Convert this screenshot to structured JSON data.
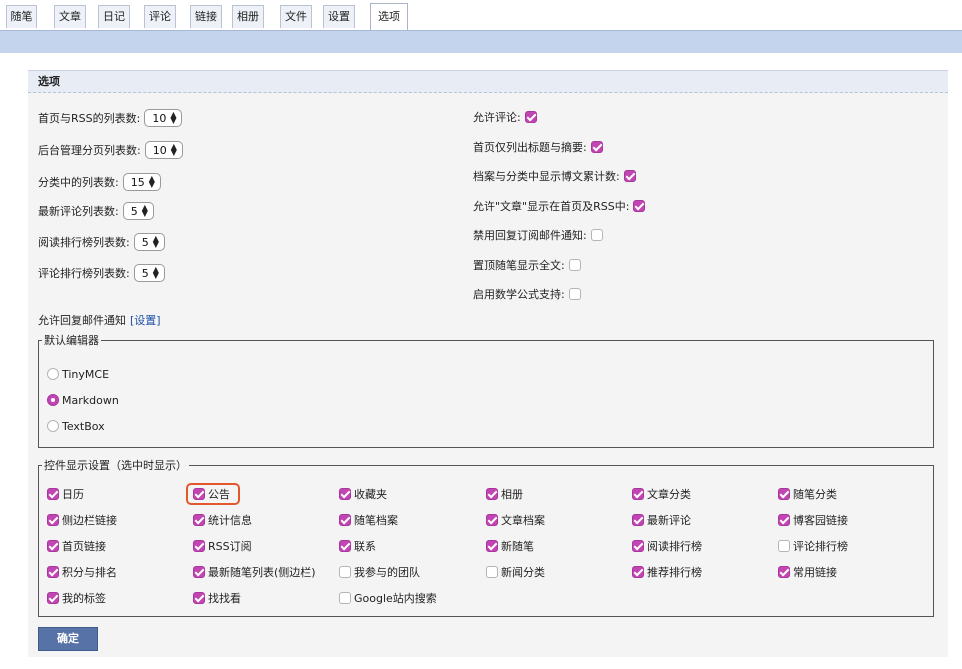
{
  "tabs": [
    "随笔",
    "文章",
    "日记",
    "评论",
    "链接",
    "相册",
    "文件",
    "设置",
    "选项"
  ],
  "active_tab": "选项",
  "panel_title": "选项",
  "left_settings": [
    {
      "label": "首页与RSS的列表数:",
      "value": "10"
    },
    {
      "label": "后台管理分页列表数:",
      "value": "10"
    },
    {
      "label": "分类中的列表数:",
      "value": "15"
    },
    {
      "label": "最新评论列表数:",
      "value": "5"
    },
    {
      "label": "阅读排行榜列表数:",
      "value": "5"
    },
    {
      "label": "评论排行榜列表数:",
      "value": "5"
    }
  ],
  "right_settings": [
    {
      "label": "允许评论:",
      "checked": true
    },
    {
      "label": "首页仅列出标题与摘要:",
      "checked": true
    },
    {
      "label": "档案与分类中显示博文累计数:",
      "checked": true
    },
    {
      "label": "允许\"文章\"显示在首页及RSS中:",
      "checked": true
    },
    {
      "label": "禁用回复订阅邮件通知:",
      "checked": false
    },
    {
      "label": "置顶随笔显示全文:",
      "checked": false
    },
    {
      "label": "启用数学公式支持:",
      "checked": false
    }
  ],
  "reply_notice": {
    "text": "允许回复邮件通知",
    "link": "[设置]"
  },
  "editor": {
    "legend": "默认编辑器",
    "options": [
      {
        "label": "TinyMCE",
        "selected": false
      },
      {
        "label": "Markdown",
        "selected": true
      },
      {
        "label": "TextBox",
        "selected": false
      }
    ]
  },
  "widgets": {
    "legend": "控件显示设置（选中时显示）",
    "rows": [
      [
        {
          "label": "日历",
          "checked": true
        },
        {
          "label": "公告",
          "checked": true,
          "highlight": true
        },
        {
          "label": "收藏夹",
          "checked": true
        },
        {
          "label": "相册",
          "checked": true
        },
        {
          "label": "文章分类",
          "checked": true
        },
        {
          "label": "随笔分类",
          "checked": true
        }
      ],
      [
        {
          "label": "侧边栏链接",
          "checked": true
        },
        {
          "label": "统计信息",
          "checked": true
        },
        {
          "label": "随笔档案",
          "checked": true
        },
        {
          "label": "文章档案",
          "checked": true
        },
        {
          "label": "最新评论",
          "checked": true
        },
        {
          "label": "博客园链接",
          "checked": true
        }
      ],
      [
        {
          "label": "首页链接",
          "checked": true
        },
        {
          "label": "RSS订阅",
          "checked": true
        },
        {
          "label": "联系",
          "checked": true
        },
        {
          "label": "新随笔",
          "checked": true
        },
        {
          "label": "阅读排行榜",
          "checked": true
        },
        {
          "label": "评论排行榜",
          "checked": false
        }
      ],
      [
        {
          "label": "积分与排名",
          "checked": true
        },
        {
          "label": "最新随笔列表(侧边栏)",
          "checked": true
        },
        {
          "label": "我参与的团队",
          "checked": false
        },
        {
          "label": "新闻分类",
          "checked": false
        },
        {
          "label": "推荐排行榜",
          "checked": true
        },
        {
          "label": "常用链接",
          "checked": true
        }
      ],
      [
        {
          "label": "我的标签",
          "checked": true
        },
        {
          "label": "找找看",
          "checked": true
        },
        {
          "label": "Google站内搜索",
          "checked": false
        }
      ]
    ]
  },
  "submit_label": "确定"
}
